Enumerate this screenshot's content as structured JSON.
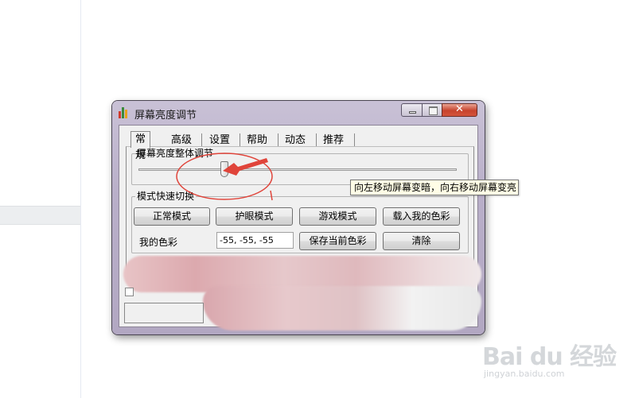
{
  "window": {
    "title": "屏幕亮度调节",
    "icon": "bar-chart-app-icon",
    "controls": [
      "minimize-icon",
      "maximize-icon",
      "close-icon"
    ]
  },
  "tabs": [
    {
      "label": "常规",
      "active": true
    },
    {
      "label": "高级",
      "active": false
    },
    {
      "label": "设置",
      "active": false
    },
    {
      "label": "帮助",
      "active": false
    },
    {
      "label": "动态",
      "active": false
    },
    {
      "label": "推荐",
      "active": false
    }
  ],
  "brightness": {
    "group_label": "屏幕亮度整体调节",
    "slider_value_fraction": 0.27,
    "tooltip": "向左移动屏幕变暗，向右移动屏幕变亮"
  },
  "modes": {
    "group_label": "模式快速切换",
    "buttons": [
      "正常模式",
      "护眼模式",
      "游戏模式",
      "载入我的色彩"
    ],
    "my_color_label": "我的色彩",
    "my_color_value": "-55, -55, -55",
    "save_button": "保存当前色彩",
    "clear_button": "清除"
  },
  "annotation": {
    "color": "#e0443a",
    "shape": "ellipse-with-arrow"
  },
  "watermark": {
    "logo": "Bai du 经验",
    "url": "jingyan.baidu.com"
  },
  "colors": {
    "title_bar": "#b9afc9",
    "close_button": "#c7432d",
    "tooltip_bg": "#fffde6"
  }
}
